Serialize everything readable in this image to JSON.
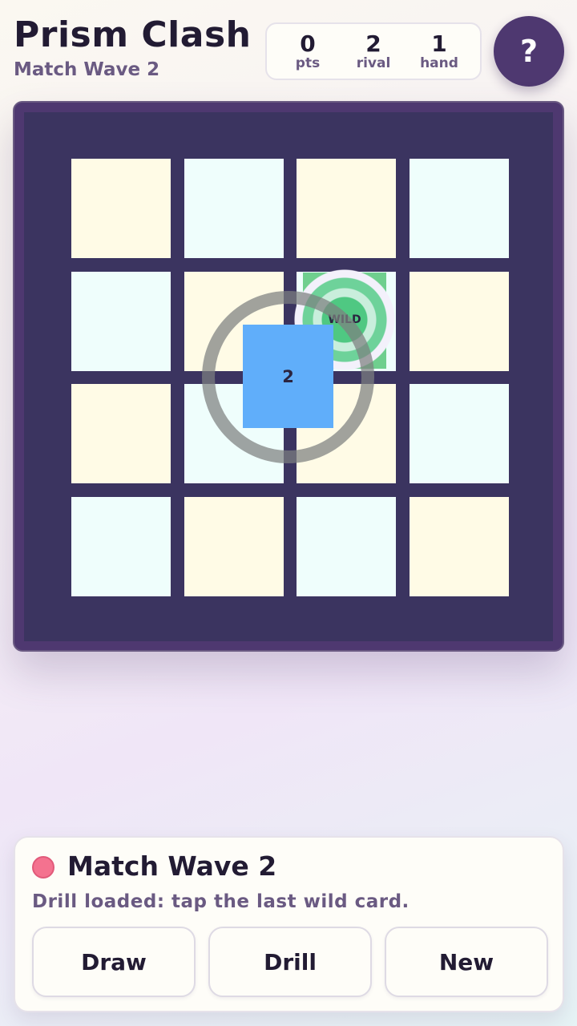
{
  "header": {
    "title": "Prism Clash",
    "subtitle": "Match Wave 2"
  },
  "stats": [
    {
      "value": "0",
      "label": "pts"
    },
    {
      "value": "2",
      "label": "rival"
    },
    {
      "value": "1",
      "label": "hand"
    }
  ],
  "help_label": "?",
  "board": {
    "rows": 4,
    "cols": 4,
    "tile_colors": [
      "#fffbe6",
      "#effefc"
    ],
    "wild_card": {
      "label": "WILD",
      "color": "#6fcf8e"
    },
    "player_card": {
      "label": "2",
      "color": "#60aefa"
    }
  },
  "panel": {
    "title": "Match Wave 2",
    "message": "Drill loaded: tap the last wild card.",
    "status_color": "#f4728f",
    "buttons": [
      "Draw",
      "Drill",
      "New"
    ]
  }
}
